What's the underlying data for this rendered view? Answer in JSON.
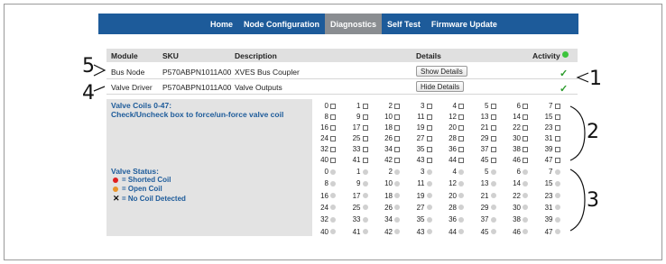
{
  "nav": {
    "items": [
      {
        "label": "Home",
        "active": false
      },
      {
        "label": "Node Configuration",
        "active": false
      },
      {
        "label": "Diagnostics",
        "active": true
      },
      {
        "label": "Self Test",
        "active": false
      },
      {
        "label": "Firmware Update",
        "active": false
      }
    ]
  },
  "table": {
    "headers": {
      "module": "Module",
      "sku": "SKU",
      "description": "Description",
      "details": "Details",
      "activity": "Activity"
    },
    "activity_color": "#3cc43c",
    "rows": [
      {
        "module": "Bus Node",
        "sku": "P570ABPN1011A00",
        "description": "XVES Bus Coupler",
        "button": "Show Details",
        "status": "ok"
      },
      {
        "module": "Valve Driver",
        "sku": "P570ABPN1011A00",
        "description": "Valve Outputs",
        "button": "Hide Details",
        "status": "ok"
      }
    ]
  },
  "valve_coils": {
    "title": "Valve Coils 0-47:",
    "instruction": "Check/Uncheck box to force/un-force valve coil",
    "numbers": [
      "0",
      "1",
      "2",
      "3",
      "4",
      "5",
      "6",
      "7",
      "8",
      "9",
      "10",
      "11",
      "12",
      "13",
      "14",
      "15",
      "16",
      "17",
      "18",
      "19",
      "20",
      "21",
      "22",
      "23",
      "24",
      "25",
      "26",
      "27",
      "28",
      "29",
      "30",
      "31",
      "32",
      "33",
      "34",
      "35",
      "36",
      "37",
      "38",
      "39",
      "40",
      "41",
      "42",
      "43",
      "44",
      "45",
      "46",
      "47"
    ]
  },
  "valve_status": {
    "title": "Valve Status:",
    "legend": [
      {
        "kind": "dot",
        "color": "#e02020",
        "label": "= Shorted Coil"
      },
      {
        "kind": "dot",
        "color": "#e8952a",
        "label": "= Open Coil"
      },
      {
        "kind": "x",
        "symbol": "✕",
        "label": "= No Coil Detected"
      }
    ],
    "numbers": [
      "0",
      "1",
      "2",
      "3",
      "4",
      "5",
      "6",
      "7",
      "8",
      "9",
      "10",
      "11",
      "12",
      "13",
      "14",
      "15",
      "16",
      "17",
      "18",
      "19",
      "20",
      "21",
      "22",
      "23",
      "24",
      "25",
      "26",
      "27",
      "28",
      "29",
      "30",
      "31",
      "32",
      "33",
      "34",
      "35",
      "36",
      "37",
      "38",
      "39",
      "40",
      "41",
      "42",
      "43",
      "44",
      "45",
      "46",
      "47"
    ],
    "indicator_color": "#d0d0d0"
  },
  "callouts": {
    "c1": "1",
    "c2": "2",
    "c3": "3",
    "c4": "4",
    "c5": "5"
  },
  "icons": {
    "check": "✓"
  }
}
